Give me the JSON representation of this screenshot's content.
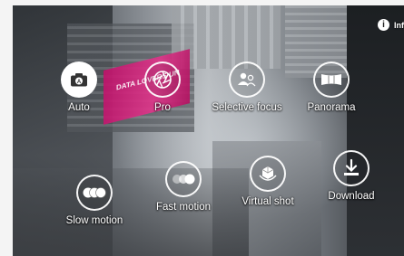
{
  "info": {
    "icon_glyph": "i",
    "label": "Info"
  },
  "billboard": {
    "text": "DATA LOVERS UN"
  },
  "modes": [
    {
      "id": "auto",
      "label": "Auto",
      "icon": "camera-icon",
      "selected": true
    },
    {
      "id": "pro",
      "label": "Pro",
      "icon": "aperture-icon",
      "selected": false
    },
    {
      "id": "selective-focus",
      "label": "Selective focus",
      "icon": "selective-focus-icon",
      "selected": false
    },
    {
      "id": "panorama",
      "label": "Panorama",
      "icon": "panorama-icon",
      "selected": false
    },
    {
      "id": "slow-motion",
      "label": "Slow motion",
      "icon": "slow-motion-icon",
      "selected": false
    },
    {
      "id": "fast-motion",
      "label": "Fast motion",
      "icon": "fast-motion-icon",
      "selected": false
    },
    {
      "id": "virtual-shot",
      "label": "Virtual shot",
      "icon": "virtual-shot-icon",
      "selected": false
    },
    {
      "id": "download",
      "label": "Download",
      "icon": "download-icon",
      "selected": false
    }
  ]
}
